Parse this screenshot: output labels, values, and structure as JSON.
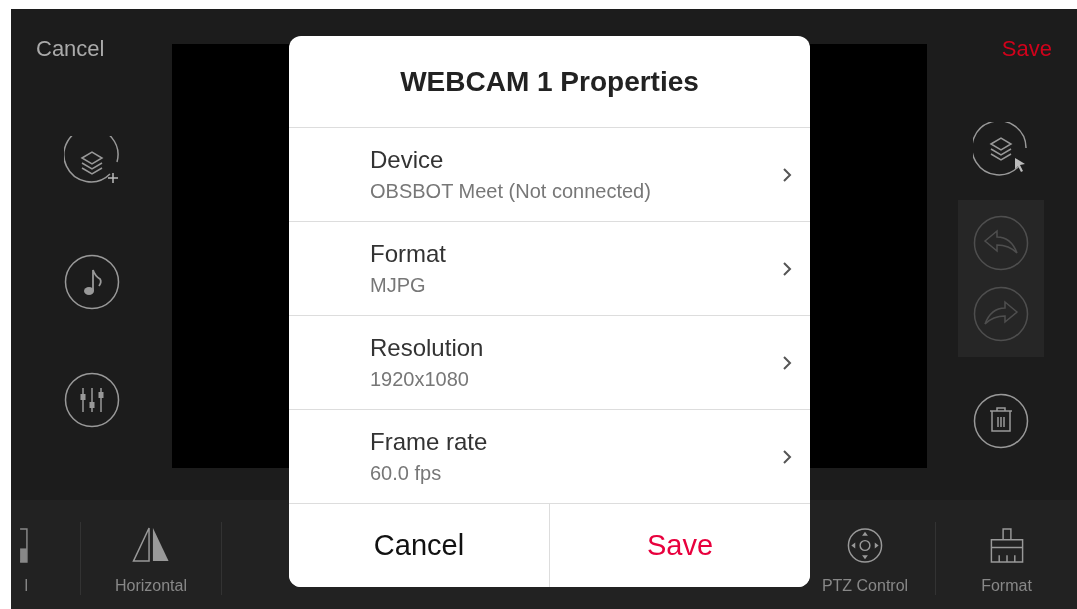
{
  "top_bar": {
    "cancel": "Cancel",
    "save": "Save"
  },
  "left_tools": [
    {
      "kind": "add-layer"
    },
    {
      "kind": "music"
    },
    {
      "kind": "mixer"
    }
  ],
  "right_tools": [
    {
      "kind": "select-layer",
      "disabled": false
    },
    {
      "kind": "undo",
      "disabled": true
    },
    {
      "kind": "redo",
      "disabled": true
    },
    {
      "kind": "delete",
      "disabled": false
    }
  ],
  "toolbar": {
    "left": [
      {
        "kind": "slider",
        "label": "l"
      },
      {
        "kind": "flip-horizontal",
        "label": "Horizontal"
      }
    ],
    "right": [
      {
        "kind": "ptz",
        "label": "PTZ Control"
      },
      {
        "kind": "format",
        "label": "Format"
      }
    ]
  },
  "dialog": {
    "title": "WEBCAM 1 Properties",
    "rows": [
      {
        "label": "Device",
        "value": "OBSBOT Meet (Not connected)"
      },
      {
        "label": "Format",
        "value": "MJPG"
      },
      {
        "label": "Resolution",
        "value": "1920x1080"
      },
      {
        "label": "Frame rate",
        "value": "60.0 fps"
      }
    ],
    "cancel": "Cancel",
    "save": "Save"
  }
}
